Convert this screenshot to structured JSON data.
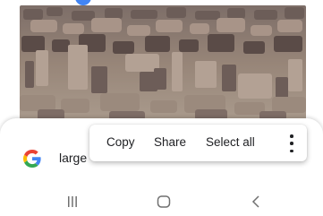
{
  "image": {
    "subject": "ruins-rubble-field",
    "colors": {
      "sky": "#e9ebec",
      "stone": "#8b7b73",
      "stone_dark": "#5e4f4a",
      "ground": "#a59484"
    }
  },
  "search": {
    "query_text": "large",
    "logo": "google-g-icon"
  },
  "selection_toolbar": {
    "copy_label": "Copy",
    "share_label": "Share",
    "select_all_label": "Select all",
    "more_icon": "more-vertical-icon"
  },
  "navigation_bar": {
    "recent_icon": "recent-apps-icon",
    "home_icon": "home-icon",
    "back_icon": "back-icon"
  },
  "theme": {
    "accent": "#4285f4",
    "text": "#202124",
    "nav_icon": "#707070"
  }
}
